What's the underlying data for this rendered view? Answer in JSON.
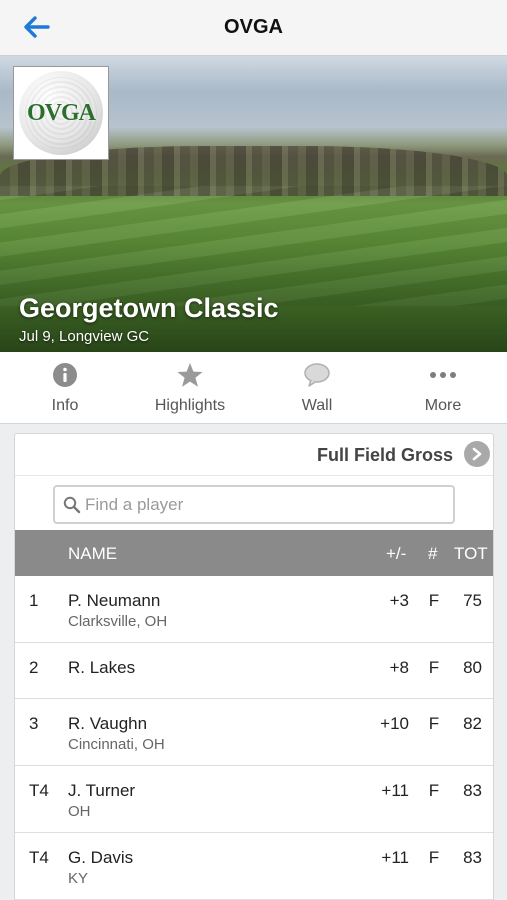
{
  "nav": {
    "title": "OVGA",
    "back_icon": "arrow-left-icon",
    "accent": "#1e7ad9"
  },
  "event": {
    "logo_text": "OVGA",
    "title": "Georgetown Classic",
    "subtitle": "Jul 9, Longview GC"
  },
  "tabs": [
    {
      "label": "Info",
      "icon": "info-icon"
    },
    {
      "label": "Highlights",
      "icon": "star-icon"
    },
    {
      "label": "Wall",
      "icon": "speech-bubble-icon"
    },
    {
      "label": "More",
      "icon": "ellipsis-icon"
    }
  ],
  "leaderboard": {
    "filter_label": "Full Field Gross",
    "search_placeholder": "Find a player",
    "columns": {
      "name": "NAME",
      "plus_minus": "+/-",
      "hole": "#",
      "total": "TOT"
    },
    "rows": [
      {
        "pos": "1",
        "name": "P. Neumann",
        "location": "Clarksville, OH",
        "plus_minus": "+3",
        "hole": "F",
        "total": "75"
      },
      {
        "pos": "2",
        "name": "R. Lakes",
        "location": "",
        "plus_minus": "+8",
        "hole": "F",
        "total": "80"
      },
      {
        "pos": "3",
        "name": "R. Vaughn",
        "location": "Cincinnati, OH",
        "plus_minus": "+10",
        "hole": "F",
        "total": "82"
      },
      {
        "pos": "T4",
        "name": "J. Turner",
        "location": "OH",
        "plus_minus": "+11",
        "hole": "F",
        "total": "83"
      },
      {
        "pos": "T4",
        "name": "G. Davis",
        "location": "KY",
        "plus_minus": "+11",
        "hole": "F",
        "total": "83"
      }
    ]
  }
}
